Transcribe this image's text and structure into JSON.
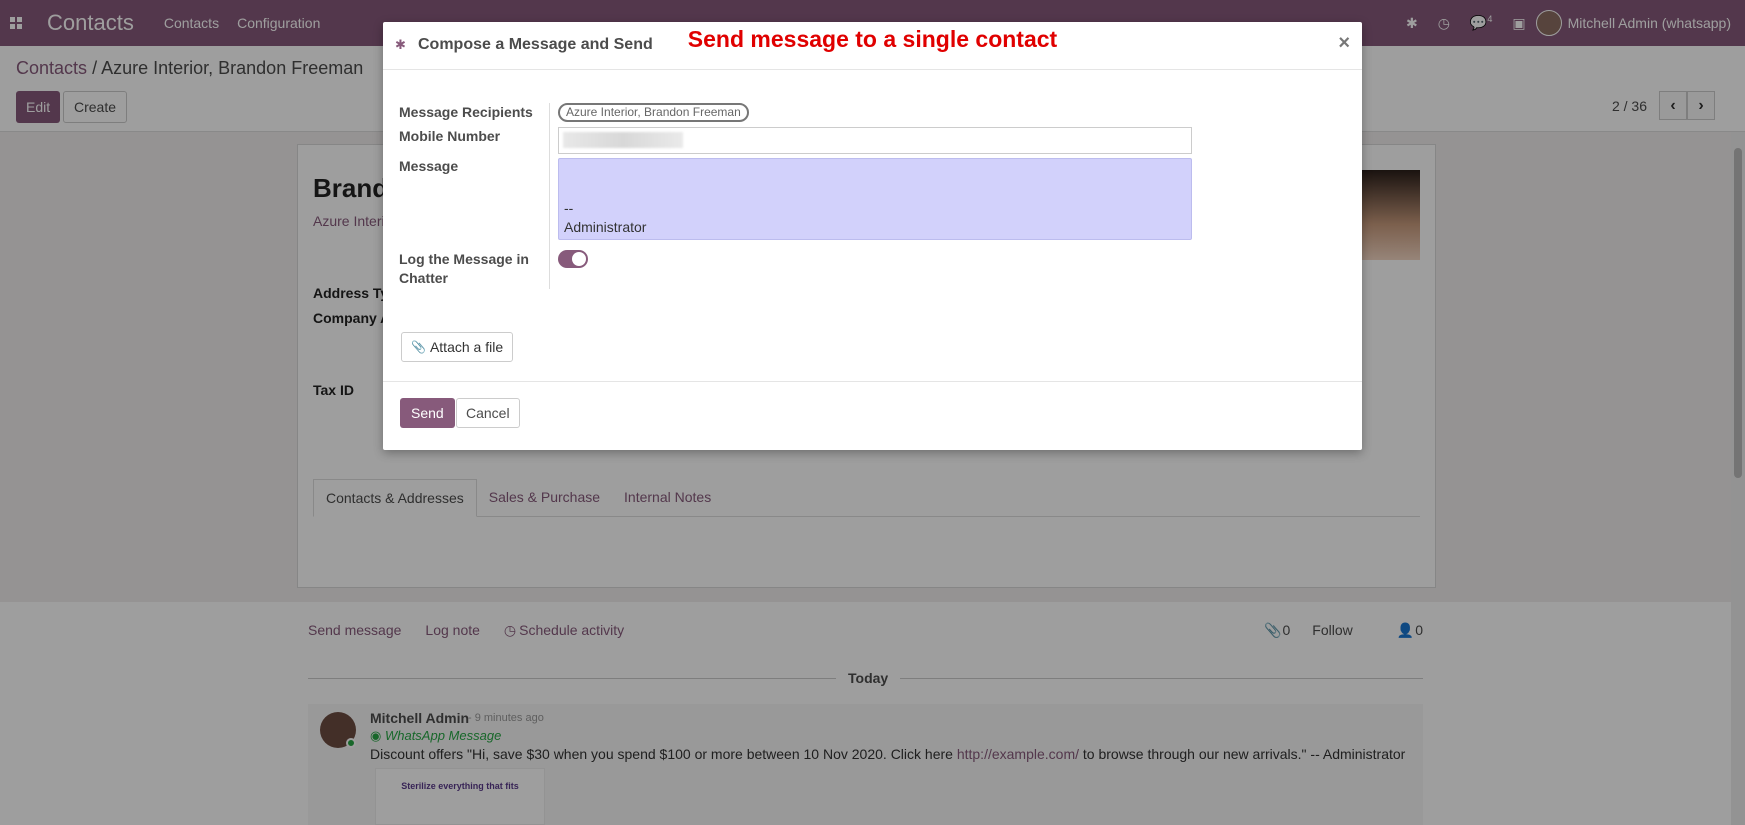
{
  "navbar": {
    "app_name": "Contacts",
    "menu": [
      "Contacts",
      "Configuration"
    ],
    "messages_count": "4",
    "user_name": "Mitchell Admin (whatsapp)"
  },
  "breadcrumb": {
    "parent": "Contacts",
    "separator": "/",
    "current": "Azure Interior, Brandon Freeman"
  },
  "toolbar": {
    "edit_label": "Edit",
    "create_label": "Create",
    "pager_value": "2 / 36"
  },
  "form": {
    "partner_name": "Brand",
    "partner_company": "Azure Interio",
    "address_type_label": "Address Ty",
    "company_address_label": "Company A",
    "tax_id_label": "Tax ID",
    "tabs": [
      "Contacts & Addresses",
      "Sales & Purchase",
      "Internal Notes"
    ]
  },
  "chatter": {
    "send_message": "Send message",
    "log_note": "Log note",
    "schedule_activity": "Schedule activity",
    "attachments_count": "0",
    "follow_label": "Follow",
    "followers_count": "0",
    "today_label": "Today",
    "message": {
      "author": "Mitchell Admin",
      "time": "- 9 minutes ago",
      "type": "WhatsApp Message",
      "body_prefix": "Discount offers \"Hi, save $30 when you spend $100 or more between 10 Nov 2020. Click here ",
      "link": "http://example.com/",
      "body_suffix": " to browse through our new arrivals.\" -- Administrator",
      "attachment_title": "Sterilize everything that fits"
    }
  },
  "modal": {
    "title": "Compose a Message and Send",
    "annotation": "Send message to a single contact",
    "close": "×",
    "recipients_label": "Message Recipients",
    "recipient": "Azure Interior, Brandon Freeman",
    "mobile_label": "Mobile Number",
    "message_label": "Message",
    "message_value": "--\nAdministrator",
    "log_label": "Log the Message in Chatter",
    "log_enabled": true,
    "attach_label": "Attach a file",
    "send_label": "Send",
    "cancel_label": "Cancel"
  },
  "colors": {
    "brand": "#875a7b",
    "annotation": "#e00000",
    "message_bg": "#d2d1fb",
    "whatsapp": "#28a745"
  }
}
